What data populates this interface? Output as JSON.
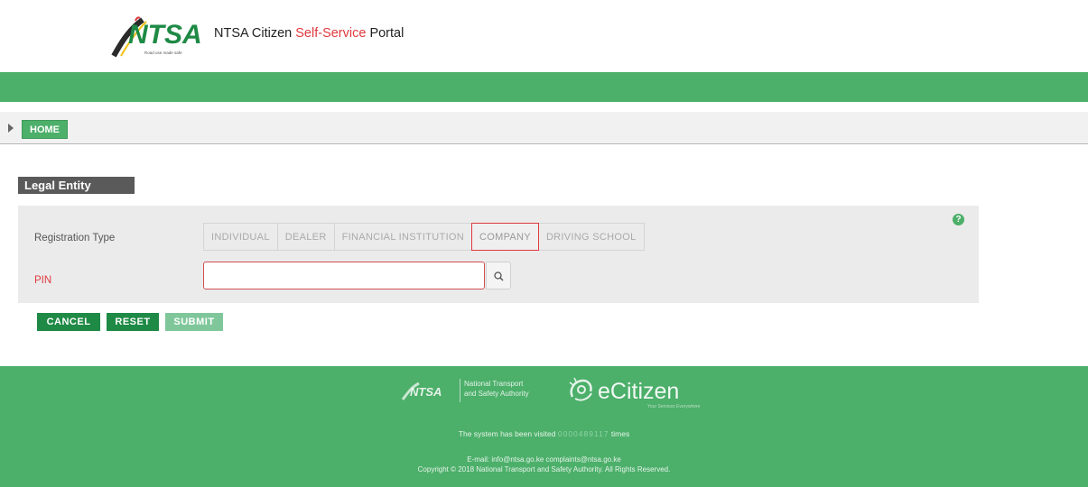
{
  "header": {
    "logo_text": "NTSA",
    "logo_tagline": "Road use made safe",
    "title_prefix": "NTSA Citizen ",
    "title_accent": "Self-Service",
    "title_suffix": " Portal"
  },
  "breadcrumb": {
    "home_label": "HOME"
  },
  "section": {
    "title": "Legal Entity"
  },
  "form": {
    "help_symbol": "?",
    "registration_type_label": "Registration Type",
    "registration_types": [
      "INDIVIDUAL",
      "DEALER",
      "FINANCIAL INSTITUTION",
      "COMPANY",
      "DRIVING SCHOOL"
    ],
    "selected_registration_type": "COMPANY",
    "pin_label": "PIN",
    "pin_value": "",
    "pin_placeholder": ""
  },
  "actions": {
    "cancel_label": "CANCEL",
    "reset_label": "RESET",
    "submit_label": "SUBMIT"
  },
  "footer": {
    "ntsa_logo_text": "NTSA",
    "ntsa_name_line1": "National Transport",
    "ntsa_name_line2": "and Safety Authority",
    "ecitizen_text": "eCitizen",
    "ecitizen_sub": "Your Services Everywhere",
    "visit_prefix": "The system has been visited ",
    "visit_count": "0000489117",
    "visit_suffix": " times",
    "email_line": "E-mail: info@ntsa.go.ke   complaints@ntsa.go.ke",
    "copyright": "Copyright © 2018 National Transport and Safety Authority. All Rights Reserved."
  },
  "colors": {
    "brand_green": "#4caf6a",
    "dark_green": "#1e8a45",
    "accent_red": "#e0393e"
  }
}
